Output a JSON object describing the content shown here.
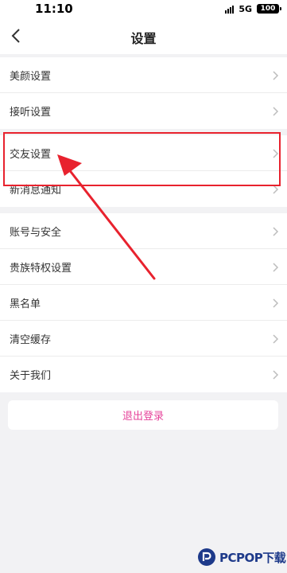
{
  "status_bar": {
    "time": "11:10",
    "network": "5G",
    "battery": "100"
  },
  "header": {
    "title": "设置"
  },
  "groups": [
    {
      "items": [
        {
          "label": "美颜设置"
        },
        {
          "label": "接听设置"
        }
      ]
    },
    {
      "items": [
        {
          "label": "交友设置"
        },
        {
          "label": "新消息通知"
        }
      ]
    },
    {
      "items": [
        {
          "label": "账号与安全"
        },
        {
          "label": "贵族特权设置"
        },
        {
          "label": "黑名单"
        },
        {
          "label": "清空缓存"
        },
        {
          "label": "关于我们"
        }
      ]
    }
  ],
  "logout": {
    "label": "退出登录",
    "color": "#e6439a"
  },
  "annotation": {
    "color": "#e8222e"
  },
  "watermark": {
    "text": "PCPOP下载",
    "color": "#1e3a8a"
  }
}
